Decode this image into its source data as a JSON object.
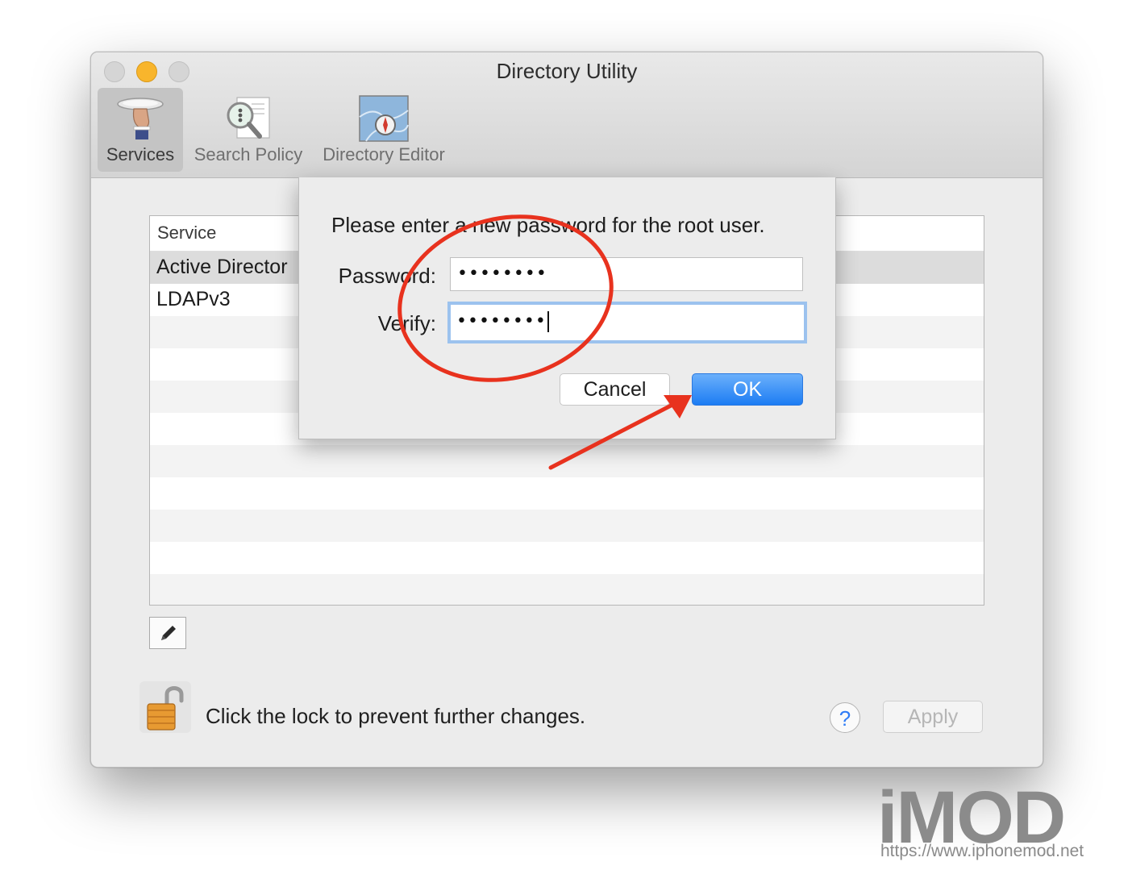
{
  "window": {
    "title": "Directory Utility"
  },
  "toolbar": {
    "items": [
      {
        "label": "Services",
        "icon": "services-icon",
        "selected": true
      },
      {
        "label": "Search Policy",
        "icon": "search-policy-icon",
        "selected": false
      },
      {
        "label": "Directory Editor",
        "icon": "directory-editor-icon",
        "selected": false
      }
    ]
  },
  "services_table": {
    "header": "Service",
    "rows": [
      "Active Director",
      "LDAPv3"
    ]
  },
  "dialog": {
    "message": "Please enter a new password for the root user.",
    "password_label": "Password:",
    "password_value": "••••••••",
    "verify_label": "Verify:",
    "verify_value": "••••••••",
    "cancel_label": "Cancel",
    "ok_label": "OK"
  },
  "footer": {
    "lock_text": "Click the lock to prevent further changes.",
    "help_label": "?",
    "apply_label": "Apply"
  },
  "watermark": {
    "logo_text": "iMOD",
    "url": "https://www.iphonemod.net"
  },
  "colors": {
    "accent": "#1c7cf3",
    "annotation": "#e8321e",
    "traffic_minimize": "#f8b52c"
  }
}
